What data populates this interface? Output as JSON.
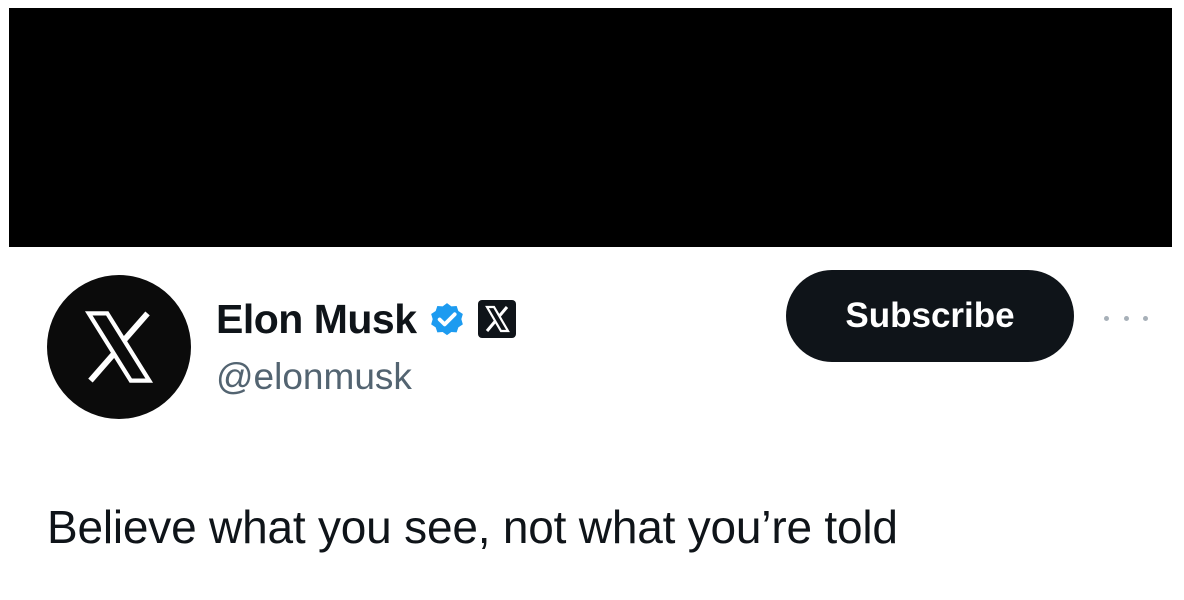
{
  "profile": {
    "display_name": "Elon Musk",
    "handle": "@elonmusk",
    "avatar_icon": "x-logo-icon",
    "verified_icon": "verified-badge-icon",
    "affiliation_icon": "x-affiliate-badge-icon"
  },
  "actions": {
    "subscribe_label": "Subscribe",
    "more_icon": "more-horizontal-icon"
  },
  "post": {
    "text": "Believe what you see, not what you’re told"
  },
  "colors": {
    "redaction": "#000000",
    "verified_blue": "#1d9bf0",
    "button_bg": "#0f1419",
    "handle_gray": "#536471"
  }
}
